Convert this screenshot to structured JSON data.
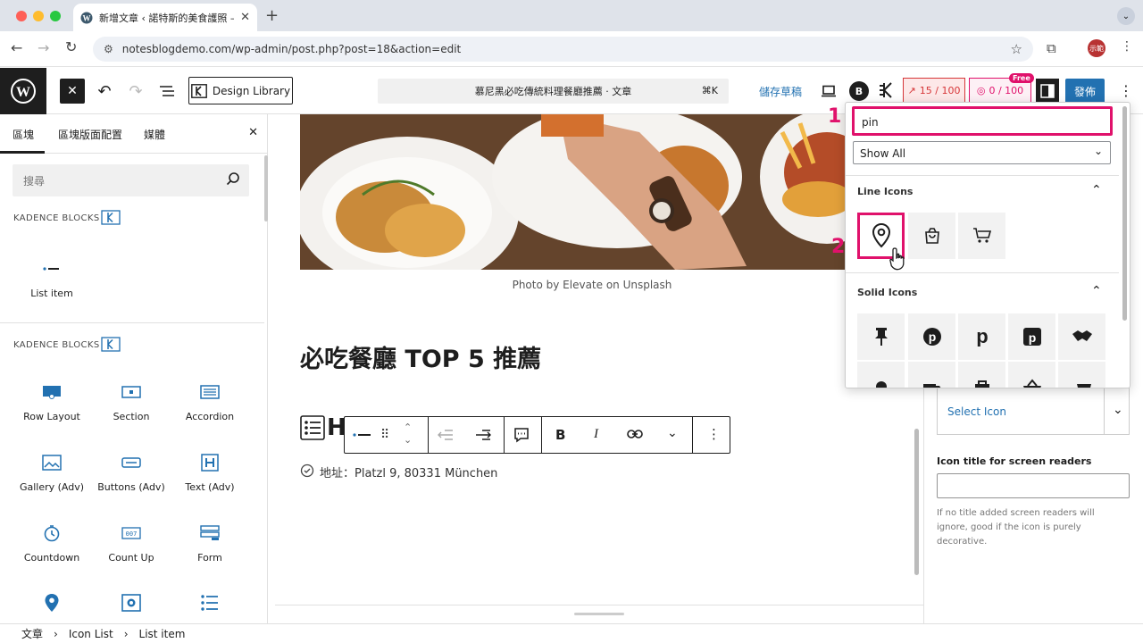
{
  "browser": {
    "tab_title": "新增文章 ‹ 諾特斯的美食護照 —",
    "url": "notesblogdemo.com/wp-admin/post.php?post=18&action=edit",
    "profile_label": "示範"
  },
  "toolbar": {
    "design_library": "Design Library",
    "doc_title": "慕尼黑必吃傳統料理餐廳推薦 · 文章",
    "shortcut": "⌘K",
    "save_draft": "儲存草稿",
    "score1": "15 / 100",
    "score2": "0 / 100",
    "free_badge": "Free",
    "publish": "發佈"
  },
  "sidebar": {
    "tabs": [
      "區塊",
      "區塊版面配置",
      "媒體"
    ],
    "search_placeholder": "搜尋",
    "section1_title": "KADENCE BLOCKS",
    "section1_items": [
      "List item"
    ],
    "section2_title": "KADENCE BLOCKS",
    "section2_items": [
      "Row Layout",
      "Section",
      "Accordion",
      "Gallery (Adv)",
      "Buttons (Adv)",
      "Text (Adv)",
      "Countdown",
      "Count Up",
      "Form"
    ]
  },
  "content": {
    "caption": "Photo by Elevate on Unsplash",
    "heading": "必吃餐廳 TOP 5 推薦",
    "list_letter": "H",
    "list_item": "地址：Platzl 9, 80331 München"
  },
  "popover": {
    "search_value": "pin",
    "filter": "Show All",
    "line_icons_title": "Line Icons",
    "solid_icons_title": "Solid Icons",
    "marker1": "1",
    "marker2": "2"
  },
  "right_panel": {
    "select_icon_placeholder": "Select Icon",
    "icon_title_label": "Icon title for screen readers",
    "icon_title_help": "If no title added screen readers will ignore, good if the icon is purely decorative."
  },
  "breadcrumb": [
    "文章",
    "Icon List",
    "List item"
  ],
  "colors": {
    "wp_blue": "#2271b1",
    "magenta": "#e0116b",
    "score_red": "#d63638"
  }
}
